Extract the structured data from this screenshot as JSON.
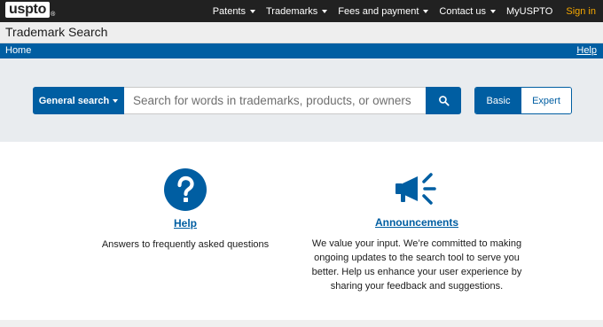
{
  "topnav": {
    "logo_text": "uspto",
    "logo_mark": "®",
    "items": [
      {
        "label": "Patents",
        "has_dropdown": true
      },
      {
        "label": "Trademarks",
        "has_dropdown": true
      },
      {
        "label": "Fees and payment",
        "has_dropdown": true
      },
      {
        "label": "Contact us",
        "has_dropdown": true
      },
      {
        "label": "MyUSPTO",
        "has_dropdown": false
      }
    ],
    "signin_label": "Sign in"
  },
  "header": {
    "title": "Trademark Search"
  },
  "breadcrumb": {
    "home_label": "Home",
    "help_label": "Help"
  },
  "search": {
    "scope_label": "General search",
    "placeholder": "Search for words in trademarks, products, or owners",
    "value": "",
    "submit_icon": "search-icon",
    "modes": [
      {
        "label": "Basic",
        "selected": true
      },
      {
        "label": "Expert",
        "selected": false
      }
    ]
  },
  "cards": [
    {
      "icon": "question-circle-icon",
      "title": "Help",
      "description": "Answers to frequently asked questions"
    },
    {
      "icon": "megaphone-icon",
      "title": "Announcements",
      "description": "We value your input. We’re committed to making ongoing updates to the search tool to serve you better. Help us enhance your user experience by sharing your feedback and suggestions."
    }
  ],
  "colors": {
    "topnav_bg": "#212121",
    "primary_blue": "#005ea2",
    "signin_gold": "#f6a800",
    "search_band_bg": "#e9ecef"
  }
}
